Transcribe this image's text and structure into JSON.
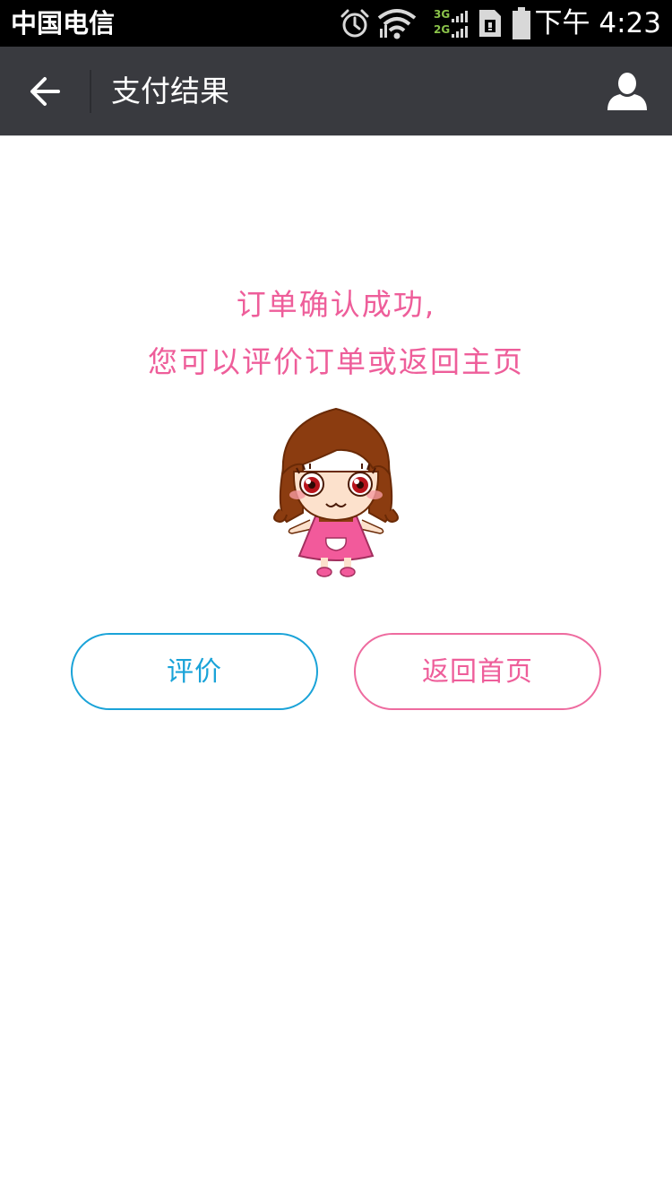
{
  "status_bar": {
    "carrier": "中国电信",
    "time": "下午 4:23",
    "network_top": "3G",
    "network_bottom": "2G",
    "icons": [
      "alarm-icon",
      "wifi-icon",
      "signal-icon",
      "sim-icon",
      "battery-icon"
    ]
  },
  "header": {
    "title": "支付结果",
    "back_icon": "arrow-left-icon",
    "user_icon": "user-icon"
  },
  "main": {
    "message_line1": "订单确认成功,",
    "message_line2": "您可以评价订单或返回主页",
    "illustration": "cartoon-girl-mascot"
  },
  "actions": {
    "review_label": "评价",
    "home_label": "返回首页"
  },
  "colors": {
    "status_bar_bg": "#000000",
    "title_bar_bg": "#393a3f",
    "accent_pink": "#ee5e9a",
    "accent_blue": "#1aa3d8"
  }
}
